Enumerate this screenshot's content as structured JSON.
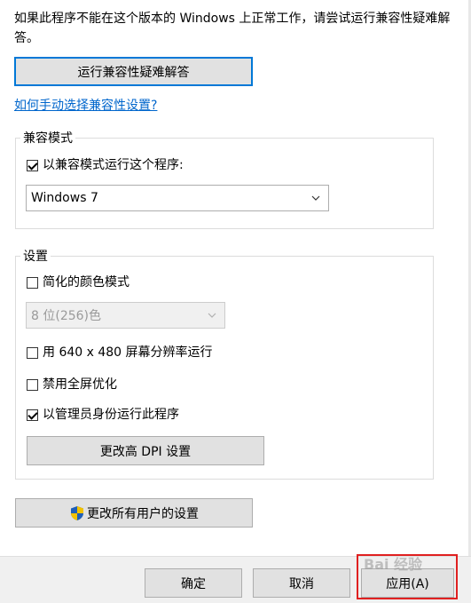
{
  "intro_text": "如果此程序不能在这个版本的 Windows 上正常工作，请尝试运行兼容性疑难解答。",
  "troubleshoot_button": "运行兼容性疑难解答",
  "manual_link": "如何手动选择兼容性设置?",
  "compat_group": {
    "title": "兼容模式",
    "checkbox_label": "以兼容模式运行这个程序:",
    "checked": true,
    "os_selected": "Windows 7"
  },
  "settings_group": {
    "title": "设置",
    "reduced_color": {
      "label": "简化的颜色模式",
      "checked": false
    },
    "color_select": "8 位(256)色",
    "resolution": {
      "label": "用 640 x 480 屏幕分辨率运行",
      "checked": false
    },
    "fullscreen_opt": {
      "label": "禁用全屏优化",
      "checked": false
    },
    "run_admin": {
      "label": "以管理员身份运行此程序",
      "checked": true
    },
    "dpi_button": "更改高 DPI 设置"
  },
  "all_users_button": "更改所有用户的设置",
  "footer": {
    "ok": "确定",
    "cancel": "取消",
    "apply": "应用(A)"
  },
  "watermark": "Bai 经验",
  "colors": {
    "accent": "#0078d7",
    "link": "#0066cc",
    "highlight_box": "#e02020"
  }
}
